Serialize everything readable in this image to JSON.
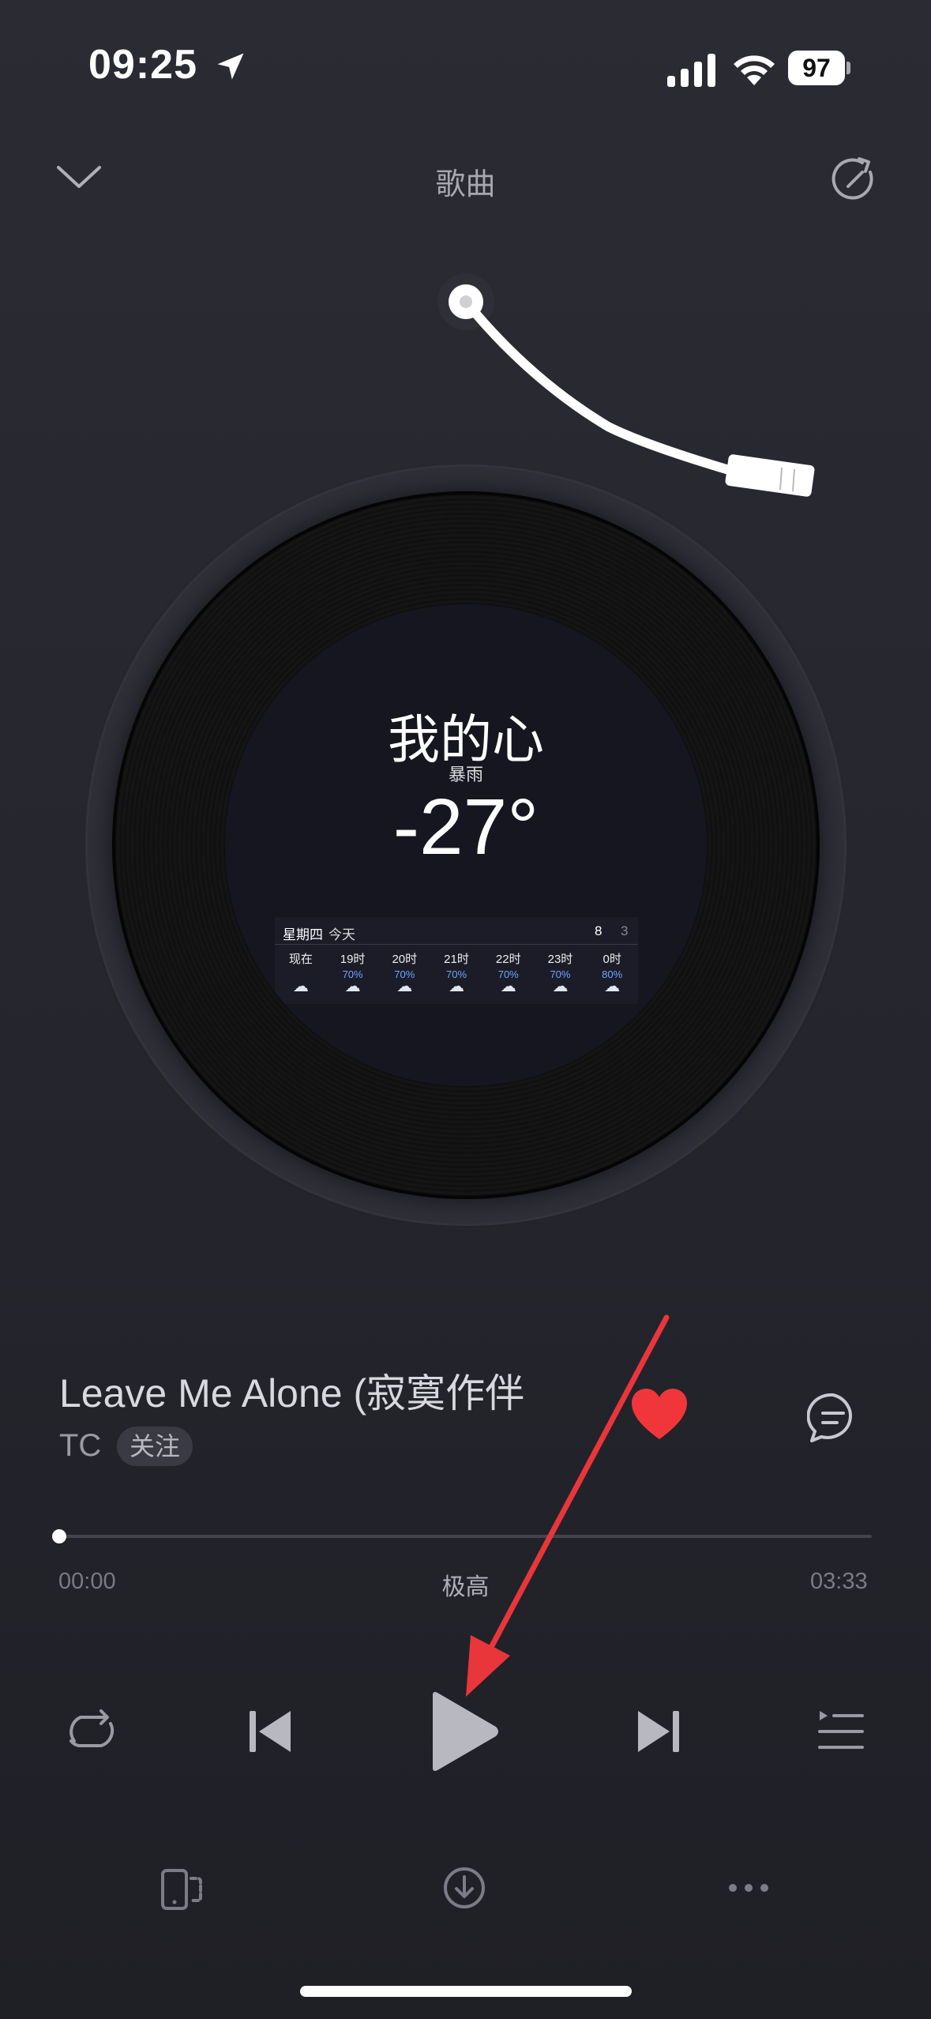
{
  "status_bar": {
    "time": "09:25",
    "battery": "97",
    "icons": [
      "location-arrow-icon",
      "signal-icon",
      "wifi-icon",
      "battery-icon"
    ]
  },
  "header": {
    "title": "歌曲",
    "left_icon": "chevron-down-icon",
    "right_icon": "share-icon"
  },
  "artwork": {
    "weather": {
      "city": "我的心",
      "condition": "暴雨",
      "temperature": "-27°",
      "day": "星期四",
      "today": "今天",
      "high": "8",
      "low": "3",
      "hours": [
        {
          "time": "现在",
          "precip": ""
        },
        {
          "time": "19时",
          "precip": "70%"
        },
        {
          "time": "20时",
          "precip": "70%"
        },
        {
          "time": "21时",
          "precip": "70%"
        },
        {
          "time": "22时",
          "precip": "70%"
        },
        {
          "time": "23时",
          "precip": "70%"
        },
        {
          "time": "0时",
          "precip": "80%"
        }
      ]
    }
  },
  "song": {
    "title": "Leave Me Alone (寂寞作伴",
    "artist": "TC",
    "follow_label": "关注",
    "liked": true
  },
  "progress": {
    "current": "00:00",
    "total": "03:33",
    "quality": "极高",
    "fraction": 0
  },
  "controls": [
    "repeat-icon",
    "previous-icon",
    "play-icon",
    "next-icon",
    "playlist-icon"
  ],
  "bottom_bar": [
    "device-icon",
    "download-icon",
    "more-icon"
  ],
  "colors": {
    "background": "#26262e",
    "heart": "#f0363a",
    "annotation_arrow": "#e8363a"
  }
}
